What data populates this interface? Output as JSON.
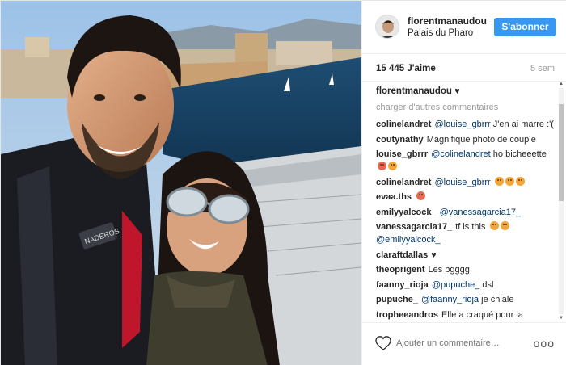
{
  "post": {
    "username": "florentmanaudou",
    "location": "Palais du Pharo",
    "follow_label": "S'abonner",
    "likes": "15 445 J'aime",
    "time": "5 sem",
    "caption_user": "florentmanaudou",
    "load_more": "charger d'autres commentaires",
    "add_comment_placeholder": "Ajouter un commentaire…",
    "more_options": "ooo",
    "jacket_logo": "NADEROS"
  },
  "comments": [
    {
      "user": "colineландret",
      "mention": "",
      "text": ""
    },
    {
      "user": "coutynathy",
      "mention": "",
      "text": "Magnifique photo de couple"
    },
    {
      "user": "louise_gbrrr",
      "mention": "@colinelandret",
      "text": "ho bicheeette"
    },
    {
      "user": "colinelandret",
      "mention": "@louise_gbrrr",
      "text": ""
    },
    {
      "user": "evaa.ths",
      "mention": "",
      "text": ""
    },
    {
      "user": "emilyyalcock_",
      "mention": "@vanessagarcia17_",
      "text": ""
    },
    {
      "user": "vanessagarcia17_",
      "mention": "",
      "text": "tf is this"
    },
    {
      "user": "",
      "mention": "@emilyyalcock_",
      "text": ""
    },
    {
      "user": "claraftdallas",
      "mention": "",
      "text": ""
    },
    {
      "user": "theoprigent",
      "mention": "",
      "text": "Les bgggg"
    },
    {
      "user": "faanny_rioja",
      "mention": "@pupuche_",
      "text": "dsl"
    },
    {
      "user": "pupuche_",
      "mention": "@faanny_rioja",
      "text": "je chiale"
    },
    {
      "user": "tropheeandros",
      "mention": "",
      "text": "Elle a craqué pour la"
    }
  ],
  "c0": {
    "user": "colinelandret",
    "mention": "@louise_gbrrr",
    "text": "J'en ai marre :'("
  },
  "colors": {
    "accent": "#3897f0",
    "mention": "#003569",
    "muted": "#999999"
  }
}
